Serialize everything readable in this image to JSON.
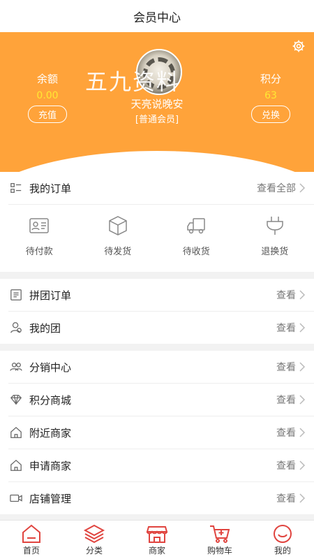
{
  "header": {
    "title": "会员中心"
  },
  "profile": {
    "balance_label": "余额",
    "balance_value": "0.00",
    "recharge_label": "充值",
    "points_label": "积分",
    "points_value": "63",
    "exchange_label": "兑换",
    "watermark": "五九资料",
    "username": "天亮说晚安",
    "level": "[普通会员]"
  },
  "orders": {
    "title": "我的订单",
    "view_all": "查看全部",
    "items": [
      {
        "label": "待付款",
        "icon": "id-card-icon"
      },
      {
        "label": "待发货",
        "icon": "box-icon"
      },
      {
        "label": "待收货",
        "icon": "truck-icon"
      },
      {
        "label": "退换货",
        "icon": "plug-icon"
      }
    ]
  },
  "group_section": [
    {
      "title": "拼团订单",
      "more": "查看",
      "icon": "list-doc-icon"
    },
    {
      "title": "我的团",
      "more": "查看",
      "icon": "user-group-icon"
    }
  ],
  "services": [
    {
      "title": "分销中心",
      "more": "查看",
      "icon": "people-icon"
    },
    {
      "title": "积分商城",
      "more": "查看",
      "icon": "diamond-icon"
    },
    {
      "title": "附近商家",
      "more": "查看",
      "icon": "home-icon"
    },
    {
      "title": "申请商家",
      "more": "查看",
      "icon": "home-icon"
    },
    {
      "title": "店铺管理",
      "more": "查看",
      "icon": "video-icon"
    }
  ],
  "tabbar": [
    {
      "label": "首页",
      "icon": "home-tab-icon"
    },
    {
      "label": "分类",
      "icon": "layers-icon"
    },
    {
      "label": "商家",
      "icon": "store-icon"
    },
    {
      "label": "购物车",
      "icon": "cart-icon"
    },
    {
      "label": "我的",
      "icon": "smile-icon"
    }
  ],
  "colors": {
    "accent": "#ffa33a",
    "value_yellow": "#ffe833",
    "tab_icon": "#e0443f"
  }
}
